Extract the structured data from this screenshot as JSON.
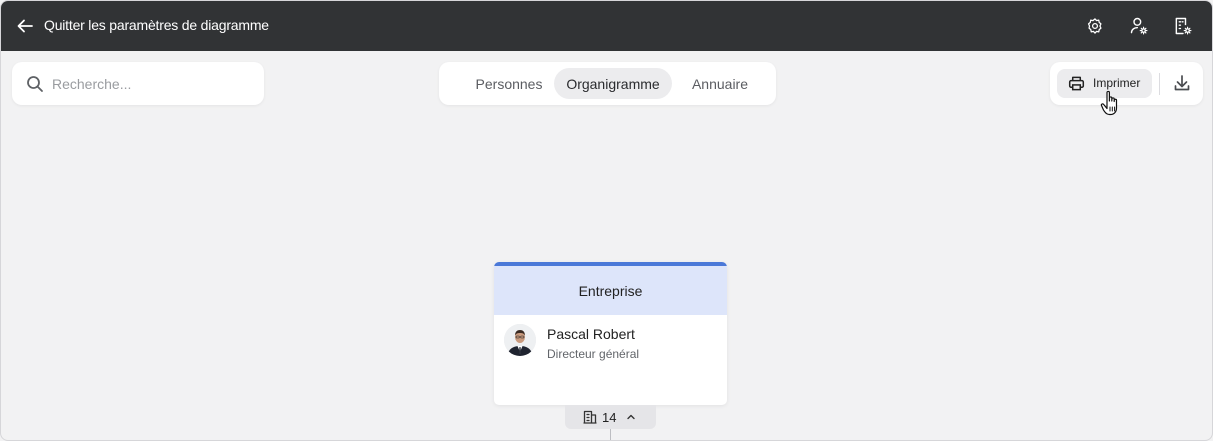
{
  "header": {
    "title": "Quitter les paramètres de diagramme",
    "back_icon": "arrow-left-icon",
    "icons": [
      "gear-icon",
      "user-settings-icon",
      "building-settings-icon"
    ]
  },
  "search": {
    "placeholder": "Recherche..."
  },
  "tabs": [
    {
      "label": "Personnes",
      "active": false
    },
    {
      "label": "Organigramme",
      "active": true
    },
    {
      "label": "Annuaire",
      "active": false
    }
  ],
  "actions": {
    "print_label": "Imprimer",
    "print_icon": "printer-icon",
    "download_icon": "download-icon"
  },
  "org_card": {
    "unit": "Entreprise",
    "person_name": "Pascal Robert",
    "person_role": "Directeur général",
    "accent_color": "#4a78d8",
    "header_color": "#dde5fa"
  },
  "children_count": {
    "value": "14",
    "icon": "building-icon",
    "chevron": "chevron-up-icon"
  },
  "colors": {
    "topbar": "#313335",
    "canvas": "#f2f2f3"
  }
}
